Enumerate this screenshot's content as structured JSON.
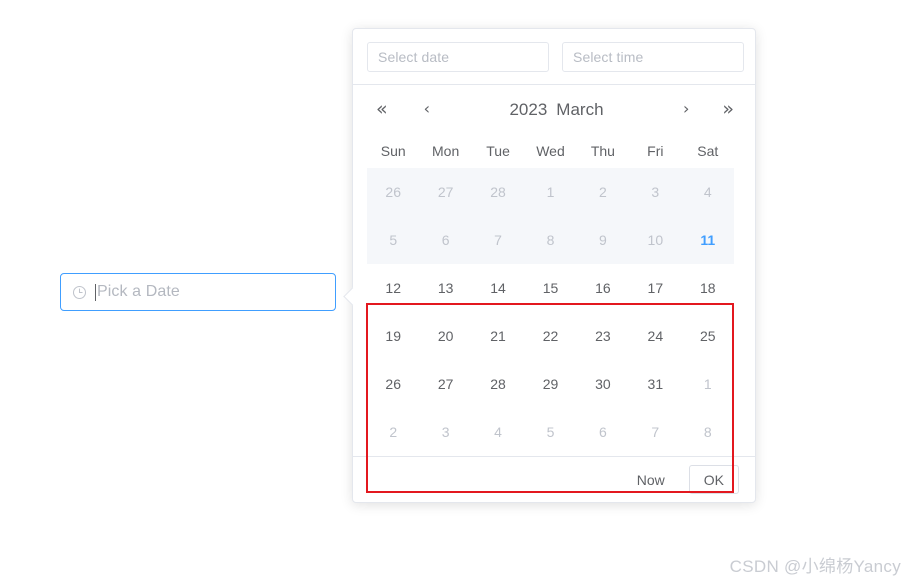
{
  "trigger": {
    "icon": "clock-icon",
    "placeholder": "Pick a Date",
    "value": "",
    "border_color": "#409eff"
  },
  "popup": {
    "date_input": {
      "placeholder": "Select date",
      "value": ""
    },
    "time_input": {
      "placeholder": "Select time",
      "value": ""
    },
    "nav": {
      "prev_year": "«",
      "prev_month": "‹",
      "year": "2023",
      "month": "March",
      "next_month": "›",
      "next_year": "»"
    },
    "weekdays": [
      "Sun",
      "Mon",
      "Tue",
      "Wed",
      "Thu",
      "Fri",
      "Sat"
    ],
    "weeks": [
      {
        "disabled": true,
        "days": [
          {
            "label": "26",
            "state": "prev-month"
          },
          {
            "label": "27",
            "state": "prev-month"
          },
          {
            "label": "28",
            "state": "prev-month"
          },
          {
            "label": "1",
            "state": "disabled"
          },
          {
            "label": "2",
            "state": "disabled"
          },
          {
            "label": "3",
            "state": "disabled"
          },
          {
            "label": "4",
            "state": "disabled"
          }
        ]
      },
      {
        "disabled": true,
        "days": [
          {
            "label": "5",
            "state": "disabled"
          },
          {
            "label": "6",
            "state": "disabled"
          },
          {
            "label": "7",
            "state": "disabled"
          },
          {
            "label": "8",
            "state": "disabled"
          },
          {
            "label": "9",
            "state": "disabled"
          },
          {
            "label": "10",
            "state": "disabled"
          },
          {
            "label": "11",
            "state": "today-selected"
          }
        ]
      },
      {
        "disabled": false,
        "days": [
          {
            "label": "12",
            "state": "available"
          },
          {
            "label": "13",
            "state": "available"
          },
          {
            "label": "14",
            "state": "available"
          },
          {
            "label": "15",
            "state": "available"
          },
          {
            "label": "16",
            "state": "available"
          },
          {
            "label": "17",
            "state": "available"
          },
          {
            "label": "18",
            "state": "available"
          }
        ]
      },
      {
        "disabled": false,
        "days": [
          {
            "label": "19",
            "state": "available"
          },
          {
            "label": "20",
            "state": "available"
          },
          {
            "label": "21",
            "state": "available"
          },
          {
            "label": "22",
            "state": "available"
          },
          {
            "label": "23",
            "state": "available"
          },
          {
            "label": "24",
            "state": "available"
          },
          {
            "label": "25",
            "state": "available"
          }
        ]
      },
      {
        "disabled": false,
        "days": [
          {
            "label": "26",
            "state": "available"
          },
          {
            "label": "27",
            "state": "available"
          },
          {
            "label": "28",
            "state": "available"
          },
          {
            "label": "29",
            "state": "available"
          },
          {
            "label": "30",
            "state": "available"
          },
          {
            "label": "31",
            "state": "available"
          },
          {
            "label": "1",
            "state": "next-month"
          }
        ]
      },
      {
        "disabled": false,
        "days": [
          {
            "label": "2",
            "state": "next-month"
          },
          {
            "label": "3",
            "state": "next-month"
          },
          {
            "label": "4",
            "state": "next-month"
          },
          {
            "label": "5",
            "state": "next-month"
          },
          {
            "label": "6",
            "state": "next-month"
          },
          {
            "label": "7",
            "state": "next-month"
          },
          {
            "label": "8",
            "state": "next-month"
          }
        ]
      }
    ],
    "footer": {
      "now_label": "Now",
      "ok_label": "OK"
    }
  },
  "annotation": {
    "box_color": "#e3181f"
  },
  "watermark": {
    "text": "CSDN @小绵杨Yancy"
  },
  "colors": {
    "primary": "#409eff",
    "text": "#606266",
    "muted": "#c0c4cc",
    "border": "#e4e7ed",
    "disabled_bg": "#f5f7fa",
    "annotation_red": "#e3181f"
  }
}
